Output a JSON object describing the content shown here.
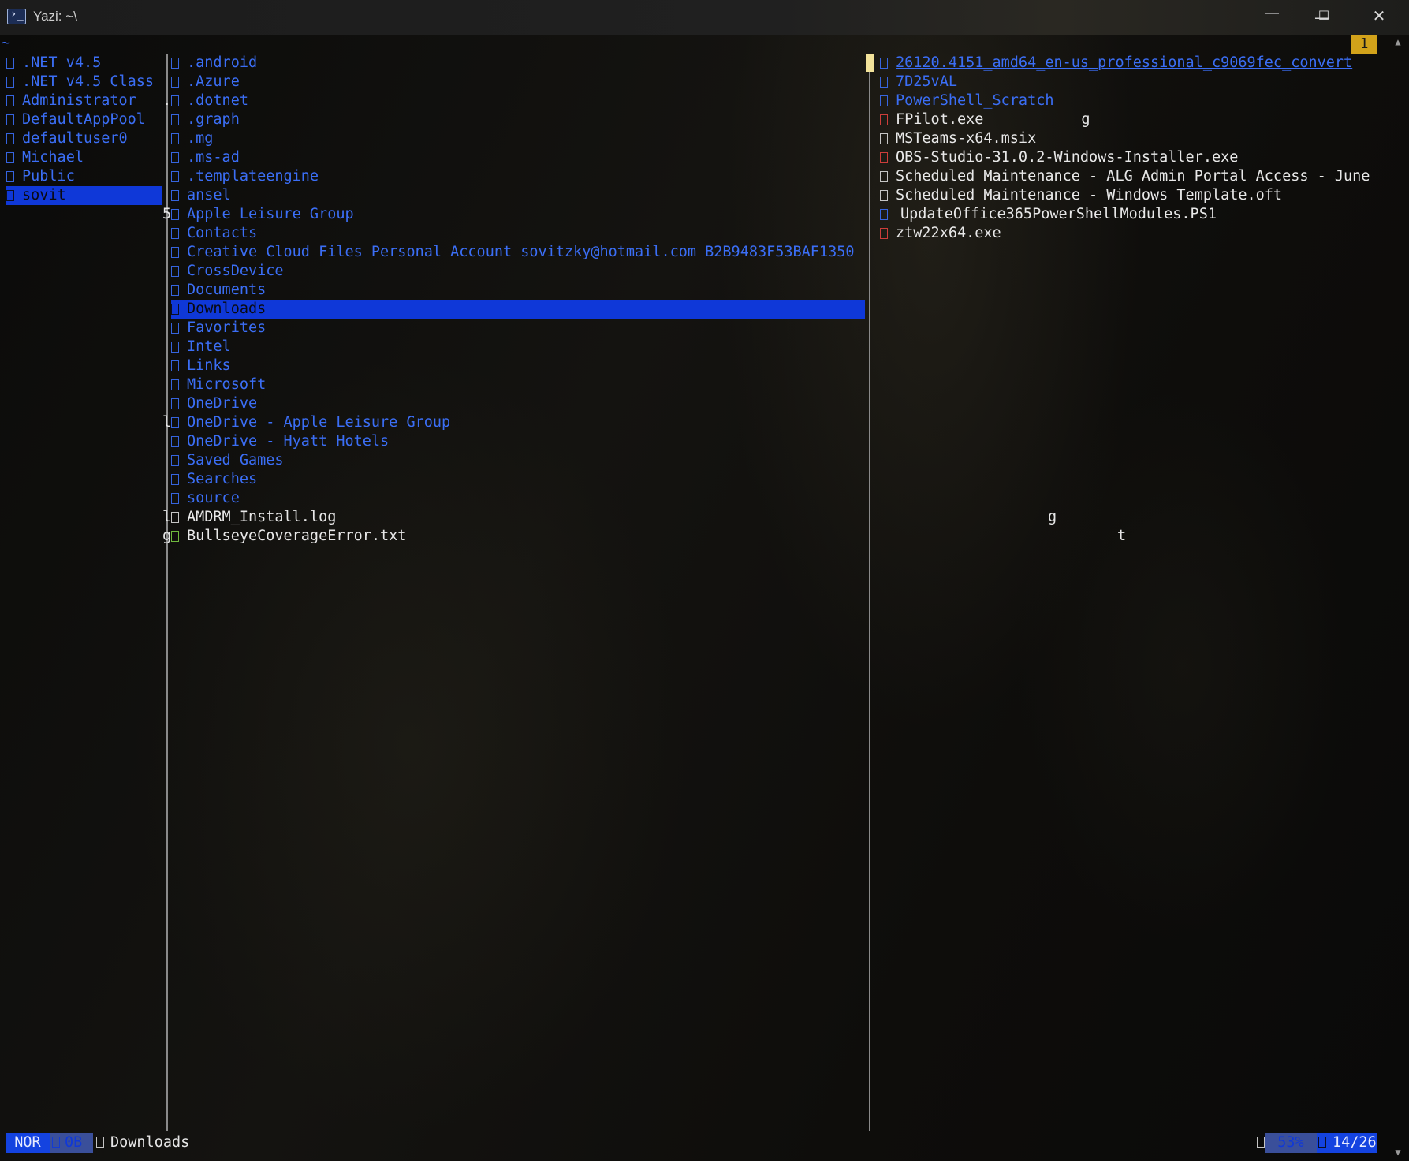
{
  "window": {
    "title": "Yazi: ~\\",
    "minimize_glyph": "—",
    "maximize_glyph": "☐",
    "close_glyph": "✕"
  },
  "tab_indicator": "~",
  "tab_badge": "1",
  "parent_pane": {
    "items": [
      {
        "name": ".NET v4.5",
        "kind": "dir"
      },
      {
        "name": ".NET v4.5 Class",
        "kind": "dir"
      },
      {
        "name": "Administrator",
        "kind": "dir"
      },
      {
        "name": "DefaultAppPool",
        "kind": "dir"
      },
      {
        "name": "defaultuser0",
        "kind": "dir"
      },
      {
        "name": "Michael",
        "kind": "dir"
      },
      {
        "name": "Public",
        "kind": "dir"
      },
      {
        "name": "sovit",
        "kind": "dir",
        "selected": true
      }
    ]
  },
  "current_pane": {
    "marks": [
      {
        "row": 2,
        "text": "."
      },
      {
        "row": 8,
        "text": "5"
      },
      {
        "row": 19,
        "text": "l"
      },
      {
        "row": 24,
        "text": "l"
      },
      {
        "row": 25,
        "text": "g"
      }
    ],
    "items": [
      {
        "name": ".android",
        "kind": "dir"
      },
      {
        "name": ".Azure",
        "kind": "dir"
      },
      {
        "name": ".dotnet",
        "kind": "dir"
      },
      {
        "name": ".graph",
        "kind": "dir"
      },
      {
        "name": ".mg",
        "kind": "dir"
      },
      {
        "name": ".ms-ad",
        "kind": "dir"
      },
      {
        "name": ".templateengine",
        "kind": "dir"
      },
      {
        "name": "ansel",
        "kind": "dir"
      },
      {
        "name": "Apple Leisure Group",
        "kind": "dir"
      },
      {
        "name": "Contacts",
        "kind": "dir"
      },
      {
        "name": "Creative Cloud Files Personal Account sovitzky@hotmail.com B2B9483F53BAF1350",
        "kind": "dir"
      },
      {
        "name": "CrossDevice",
        "kind": "dir"
      },
      {
        "name": "Documents",
        "kind": "dir"
      },
      {
        "name": "Downloads",
        "kind": "dir",
        "selected": true
      },
      {
        "name": "Favorites",
        "kind": "dir"
      },
      {
        "name": "Intel",
        "kind": "dir"
      },
      {
        "name": "Links",
        "kind": "dir"
      },
      {
        "name": "Microsoft",
        "kind": "dir"
      },
      {
        "name": "OneDrive",
        "kind": "dir"
      },
      {
        "name": "OneDrive - Apple Leisure Group",
        "kind": "dir"
      },
      {
        "name": "OneDrive - Hyatt Hotels",
        "kind": "dir"
      },
      {
        "name": "Saved Games",
        "kind": "dir"
      },
      {
        "name": "Searches",
        "kind": "dir"
      },
      {
        "name": "source",
        "kind": "dir"
      },
      {
        "name": "AMDRM_Install.log",
        "kind": "file",
        "icon_color": "white"
      },
      {
        "name": "BullseyeCoverageError.txt",
        "kind": "file",
        "icon_color": "green"
      }
    ],
    "stray_glyphs": [
      {
        "row": 24,
        "text": "g"
      },
      {
        "row": 25,
        "text": "t"
      }
    ]
  },
  "preview_pane": {
    "items": [
      {
        "name": "26120.4151_amd64_en-us_professional_c9069fec_convert",
        "kind": "dir",
        "underline": true
      },
      {
        "name": "7D25vAL",
        "kind": "dir"
      },
      {
        "name": "PowerShell_Scratch",
        "kind": "dir"
      },
      {
        "name": "FPilot.exe",
        "kind": "file",
        "icon_color": "red",
        "trailing": "g"
      },
      {
        "name": "MSTeams-x64.msix",
        "kind": "file",
        "icon_color": "white"
      },
      {
        "name": "OBS-Studio-31.0.2-Windows-Installer.exe",
        "kind": "file",
        "icon_color": "red"
      },
      {
        "name": "Scheduled Maintenance - ALG Admin Portal Access - June",
        "kind": "file",
        "icon_color": "white"
      },
      {
        "name": "Scheduled Maintenance - Windows Template.oft",
        "kind": "file",
        "icon_color": "white"
      },
      {
        "name": "UpdateOffice365PowerShellModules.PS1",
        "kind": "file",
        "icon_color": "blue",
        "wide_gap": true
      },
      {
        "name": "ztw22x64.exe",
        "kind": "file",
        "icon_color": "red"
      }
    ]
  },
  "statusbar": {
    "mode": "NOR",
    "size": "0B",
    "current_name": "Downloads",
    "percent": "53%",
    "position": "14/26"
  },
  "colors": {
    "dir": "#3b6ef5",
    "highlight": "#0f38d8",
    "badge": "#d2a21a",
    "status_mode_bg": "#1443e0"
  }
}
